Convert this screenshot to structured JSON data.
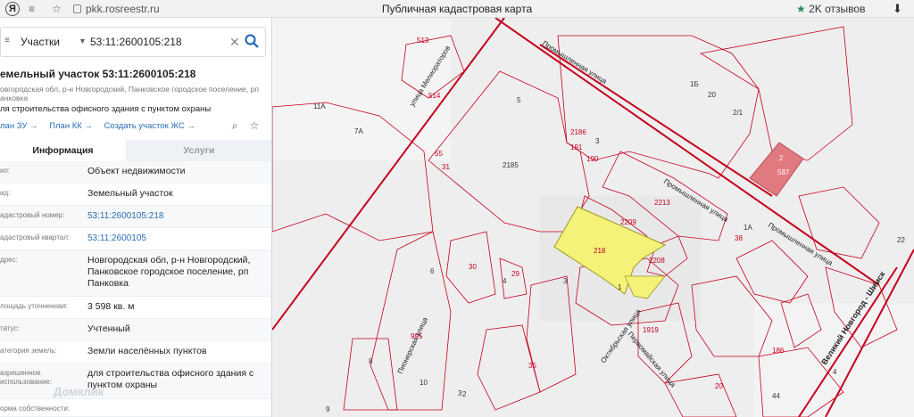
{
  "browser": {
    "logo": "Я",
    "url": "pkk.rosreestr.ru",
    "title": "Публичная кадастровая карта",
    "reviews": "2K отзывов"
  },
  "search": {
    "category": "Участки",
    "value": "53:11:2600105:218"
  },
  "parcel": {
    "title": "емельный участок 53:11:2600105:218",
    "address_line1": "овгородская обл, р-н Новгородский, Панковское городское поселение, рп",
    "address_line2": "анковка",
    "purpose": "ля строительства офисного здания с пунктом охраны",
    "links": [
      "лан ЗУ",
      "План КК",
      "Создать участок ЖС"
    ]
  },
  "tabs": [
    "Информация",
    "Услуги"
  ],
  "rows": [
    {
      "key": "ип:",
      "value": "Объект недвижимости",
      "link": false
    },
    {
      "key": "ид:",
      "value": "Земельный участок",
      "link": false
    },
    {
      "key": "адастровый номер:",
      "value": "53:11:2600105:218",
      "link": true
    },
    {
      "key": "адастровый квартал:",
      "value": "53:11:2600105",
      "link": true
    },
    {
      "key": "дрес:",
      "value": "Новгородская обл, р-н Новгородский, Панковское городское поселение, рп Панковка",
      "link": false
    },
    {
      "key": "лощадь уточненная:",
      "value": "3 598 кв. м",
      "link": false
    },
    {
      "key": "татус:",
      "value": "Учтенный",
      "link": false
    },
    {
      "key": "атегория земель:",
      "value": "Земли населённых пунктов",
      "link": false
    },
    {
      "key": "азрешенное использование:",
      "value": "для строительства офисного здания с пунктом охраны",
      "link": false
    },
    {
      "key": "орма собственности:",
      "value": "",
      "link": false
    }
  ],
  "watermark": "Домклик",
  "map": {
    "highlight_color": "#f5f27a",
    "line_color": "#c5001d",
    "labels": [
      {
        "t": "513"
      },
      {
        "t": "5"
      },
      {
        "t": "11А"
      },
      {
        "t": "7А"
      },
      {
        "t": "1Б"
      },
      {
        "t": "20"
      },
      {
        "t": "2/1"
      },
      {
        "t": "2185"
      },
      {
        "t": "2186"
      },
      {
        "t": "191"
      },
      {
        "t": "190"
      },
      {
        "t": "3"
      },
      {
        "t": "2213"
      },
      {
        "t": "2209"
      },
      {
        "t": "218"
      },
      {
        "t": "2208"
      },
      {
        "t": "2"
      },
      {
        "t": "587"
      },
      {
        "t": "38"
      },
      {
        "t": "1А"
      },
      {
        "t": "30"
      },
      {
        "t": "29"
      },
      {
        "t": "4"
      },
      {
        "t": "3"
      },
      {
        "t": "1"
      },
      {
        "t": "8"
      },
      {
        "t": "995"
      },
      {
        "t": "10"
      },
      {
        "t": "1919"
      },
      {
        "t": "186"
      },
      {
        "t": "20"
      },
      {
        "t": "44"
      },
      {
        "t": "22"
      },
      {
        "t": "4"
      },
      {
        "t": "9"
      },
      {
        "t": "3"
      },
      {
        "t": "6"
      },
      {
        "t": "55"
      },
      {
        "t": "31"
      },
      {
        "t": "514"
      },
      {
        "t": "35"
      },
      {
        "t": "2"
      }
    ],
    "streets": [
      {
        "t": "улица Мелиораторов"
      },
      {
        "t": "Промышленная улица"
      },
      {
        "t": "Промышленная улица"
      },
      {
        "t": "Промышленная улица"
      },
      {
        "t": "Великий Новгород - Шимск"
      },
      {
        "t": "Октябрьская улица"
      },
      {
        "t": "Первомайская улица"
      },
      {
        "t": "Пионерская улица"
      }
    ]
  }
}
